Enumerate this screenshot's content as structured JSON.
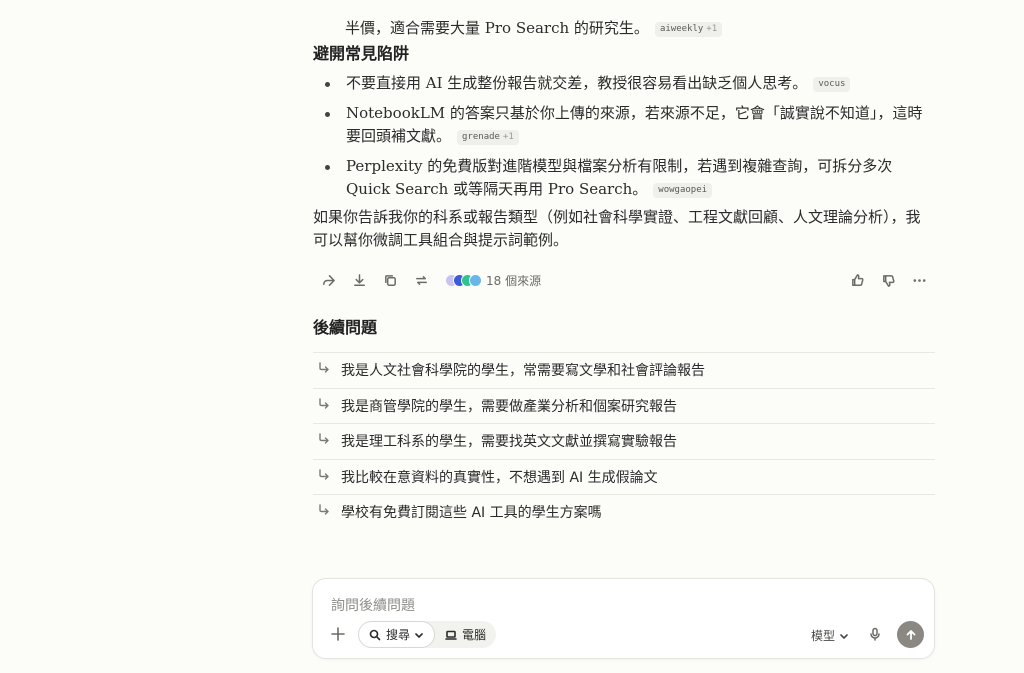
{
  "top_fragment": {
    "line2": "半價，適合需要大量 Pro Search 的研究生。",
    "cite": "aiweekly",
    "cite_plus": "+1"
  },
  "pitfalls": {
    "heading": "避開常見陷阱",
    "items": [
      {
        "text": "不要直接用 AI 生成整份報告就交差，教授很容易看出缺乏個人思考。",
        "cite": "vocus",
        "cite_plus": ""
      },
      {
        "text": "NotebookLM 的答案只基於你上傳的來源，若來源不足，它會「誠實說不知道」，這時要回頭補文獻。",
        "cite": "grenade",
        "cite_plus": "+1"
      },
      {
        "text": "Perplexity 的免費版對進階模型與檔案分析有限制，若遇到複雜查詢，可拆分多次 Quick Search 或等隔天再用 Pro Search。",
        "cite": "wowgaopei",
        "cite_plus": ""
      }
    ]
  },
  "closing": "如果你告訴我你的科系或報告類型（例如社會科學實證、工程文獻回顧、人文理論分析），我可以幫你微調工具組合與提示詞範例。",
  "actions": {
    "sources_count": "18 個來源",
    "favicon_colors": [
      "#c9c3f0",
      "#3d5bd8",
      "#2fc48f",
      "#6ab6e8"
    ]
  },
  "followups": {
    "heading": "後續問題",
    "items": [
      "我是人文社會科學院的學生，常需要寫文學和社會評論報告",
      "我是商管學院的學生，需要做產業分析和個案研究報告",
      "我是理工科系的學生，需要找英文文獻並撰寫實驗報告",
      "我比較在意資料的真實性，不想遇到 AI 生成假論文",
      "學校有免費訂閱這些 AI 工具的學生方案嗎"
    ]
  },
  "composer": {
    "placeholder": "詢問後續問題",
    "search_label": "搜尋",
    "computer_label": "電腦",
    "model_label": "模型"
  }
}
